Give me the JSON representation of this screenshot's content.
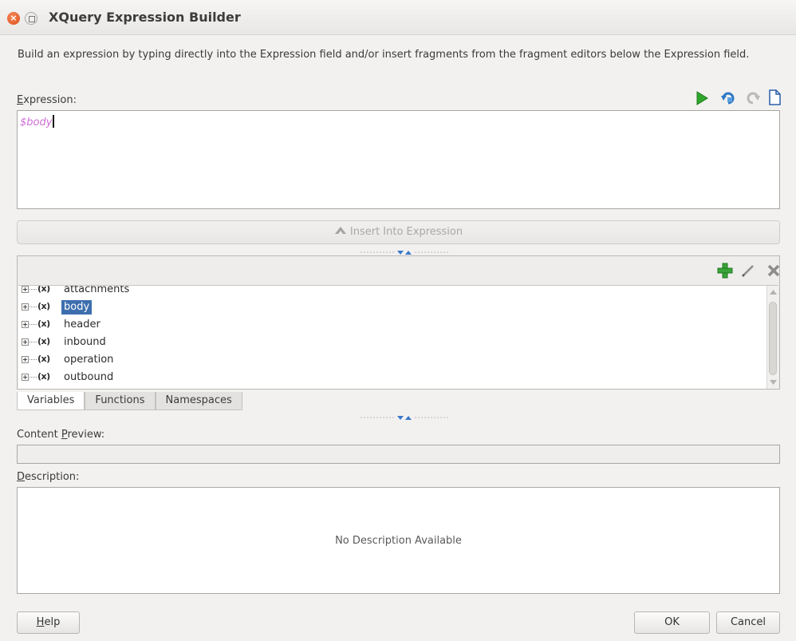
{
  "window": {
    "title": "XQuery Expression Builder"
  },
  "intro_text": "Build an expression by typing directly into the Expression field and/or insert fragments from the fragment editors below the Expression field.",
  "expression": {
    "label_prefix": "E",
    "label_rest": "xpression:",
    "value": "$body",
    "toolbar": [
      "run-icon",
      "undo-icon",
      "redo-icon",
      "new-document-icon"
    ]
  },
  "insert_button": {
    "label": "Insert Into Expression"
  },
  "fragment_toolbar": [
    "add-icon",
    "edit-icon",
    "delete-icon"
  ],
  "variables": {
    "items": [
      {
        "icon": "(x)",
        "label": "attachments",
        "selected": false
      },
      {
        "icon": "(x)",
        "label": "body",
        "selected": true
      },
      {
        "icon": "(x)",
        "label": "header",
        "selected": false
      },
      {
        "icon": "(x)",
        "label": "inbound",
        "selected": false
      },
      {
        "icon": "(x)",
        "label": "operation",
        "selected": false
      },
      {
        "icon": "(x)",
        "label": "outbound",
        "selected": false
      }
    ]
  },
  "tabs": [
    {
      "label": "Variables",
      "active": true
    },
    {
      "label": "Functions",
      "active": false
    },
    {
      "label": "Namespaces",
      "active": false
    }
  ],
  "content_preview": {
    "label_before": "Content ",
    "label_mnemonic": "P",
    "label_after": "review:"
  },
  "description": {
    "label_mnemonic": "D",
    "label_rest": "escription:",
    "text": "No Description Available"
  },
  "buttons": {
    "help_mnemonic": "H",
    "help_rest": "elp",
    "ok": "OK",
    "cancel": "Cancel"
  }
}
